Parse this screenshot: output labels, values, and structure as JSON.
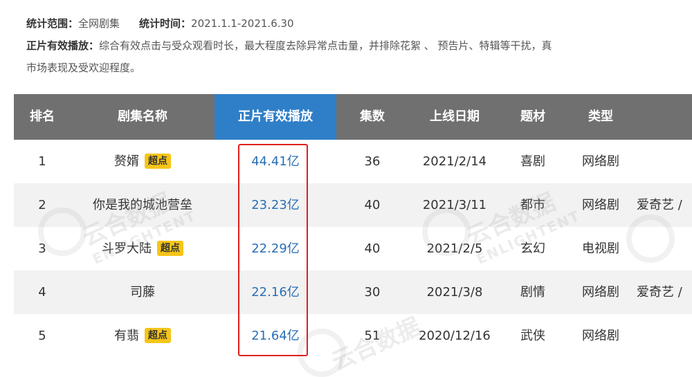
{
  "notes": {
    "scope_label": "统计范围：",
    "scope_value": "全网剧集",
    "time_label": "统计时间：",
    "time_value": "2021.1.1-2021.6.30",
    "def_label": "正片有效播放：",
    "def_value": "综合有效点击与受众观看时长，最大程度去除异常点击量，并排除花絮 、 预告片、特辑等干扰，真",
    "def_value_line2": "市场表现及受欢迎程度。"
  },
  "table": {
    "headers": {
      "rank": "排名",
      "name": "剧集名称",
      "plays": "正片有效播放",
      "episodes": "集数",
      "date": "上线日期",
      "genre": "题材",
      "type": "类型"
    },
    "rows": [
      {
        "rank": "1",
        "name": "赘婿",
        "badge": "超点",
        "plays": "44.41亿",
        "episodes": "36",
        "date": "2021/2/14",
        "genre": "喜剧",
        "type": "网络剧",
        "platform": ""
      },
      {
        "rank": "2",
        "name": "你是我的城池营垒",
        "badge": "",
        "plays": "23.23亿",
        "episodes": "40",
        "date": "2021/3/11",
        "genre": "都市",
        "type": "网络剧",
        "platform": "爱奇艺 /"
      },
      {
        "rank": "3",
        "name": "斗罗大陆",
        "badge": "超点",
        "plays": "22.29亿",
        "episodes": "40",
        "date": "2021/2/5",
        "genre": "玄幻",
        "type": "电视剧",
        "platform": ""
      },
      {
        "rank": "4",
        "name": "司藤",
        "badge": "",
        "plays": "22.16亿",
        "episodes": "30",
        "date": "2021/3/8",
        "genre": "剧情",
        "type": "网络剧",
        "platform": "爱奇艺 /"
      },
      {
        "rank": "5",
        "name": "有翡",
        "badge": "超点",
        "plays": "21.64亿",
        "episodes": "51",
        "date": "2020/12/16",
        "genre": "武侠",
        "type": "网络剧",
        "platform": ""
      }
    ]
  },
  "watermark": {
    "cn": "云合数据",
    "en": "ENLIGHTENT"
  },
  "colors": {
    "header_bg": "#707070",
    "header_active": "#2f7fc8",
    "plays_text": "#2a6fb5",
    "badge_bg": "#f5c518",
    "highlight_border": "#e0201e",
    "alt_row": "#f2f2f2"
  }
}
